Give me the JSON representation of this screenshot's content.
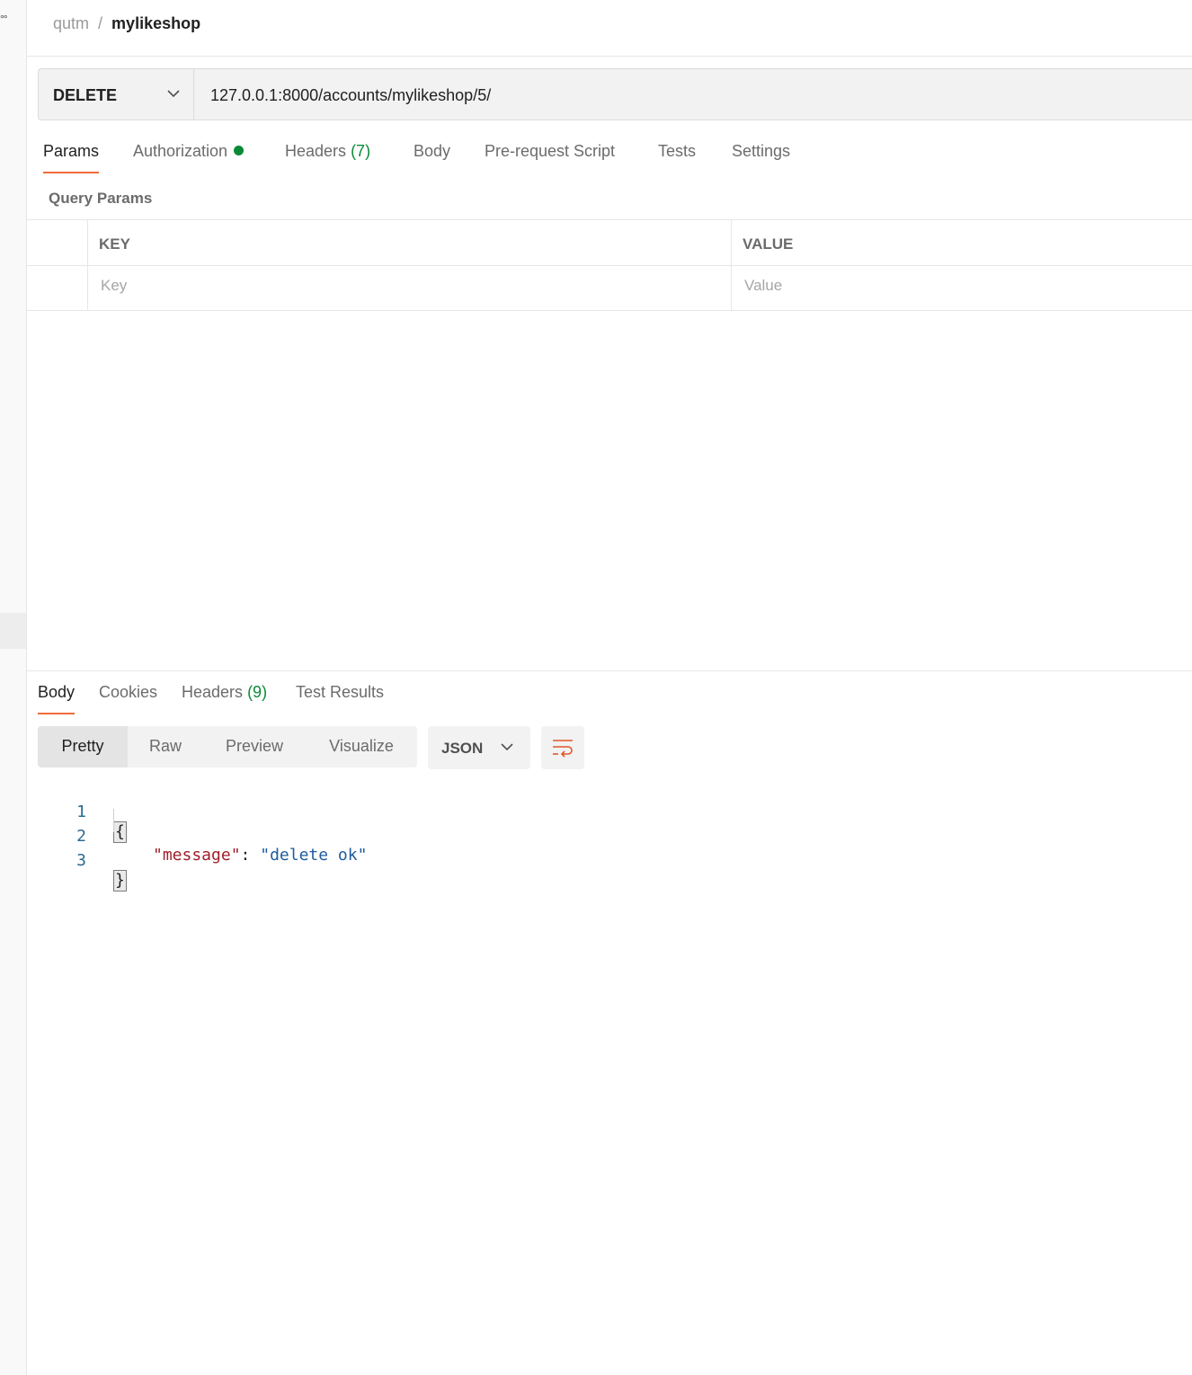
{
  "sidebar": {
    "more_glyph": "°°"
  },
  "breadcrumb": {
    "parent": "qutm",
    "separator": "/",
    "current": "mylikeshop"
  },
  "request": {
    "method": "DELETE",
    "url": "127.0.0.1:8000/accounts/mylikeshop/5/"
  },
  "request_tabs": {
    "params": "Params",
    "authorization": "Authorization",
    "headers": "Headers",
    "headers_count": "(7)",
    "body": "Body",
    "prerequest": "Pre-request Script",
    "tests": "Tests",
    "settings": "Settings"
  },
  "query_params": {
    "label": "Query Params",
    "columns": {
      "key": "KEY",
      "value": "VALUE"
    },
    "placeholders": {
      "key": "Key",
      "value": "Value"
    }
  },
  "response_tabs": {
    "body": "Body",
    "cookies": "Cookies",
    "headers": "Headers",
    "headers_count": "(9)",
    "test_results": "Test Results"
  },
  "view_modes": {
    "pretty": "Pretty",
    "raw": "Raw",
    "preview": "Preview",
    "visualize": "Visualize"
  },
  "format": "JSON",
  "response_body": {
    "line_numbers": [
      "1",
      "2",
      "3"
    ],
    "open_brace": "{",
    "key": "\"message\"",
    "colon": ": ",
    "value": "\"delete ok\"",
    "close_brace": "}"
  },
  "colors": {
    "accent": "#f26b3a",
    "success": "#0a8a36",
    "json_key": "#a01f2a",
    "json_string": "#1d5c9e"
  },
  "icons": {
    "method_dropdown": "chevron-down-icon",
    "format_dropdown": "chevron-down-icon",
    "wrap": "wrap-lines-icon",
    "auth_status": "status-dot-icon"
  }
}
